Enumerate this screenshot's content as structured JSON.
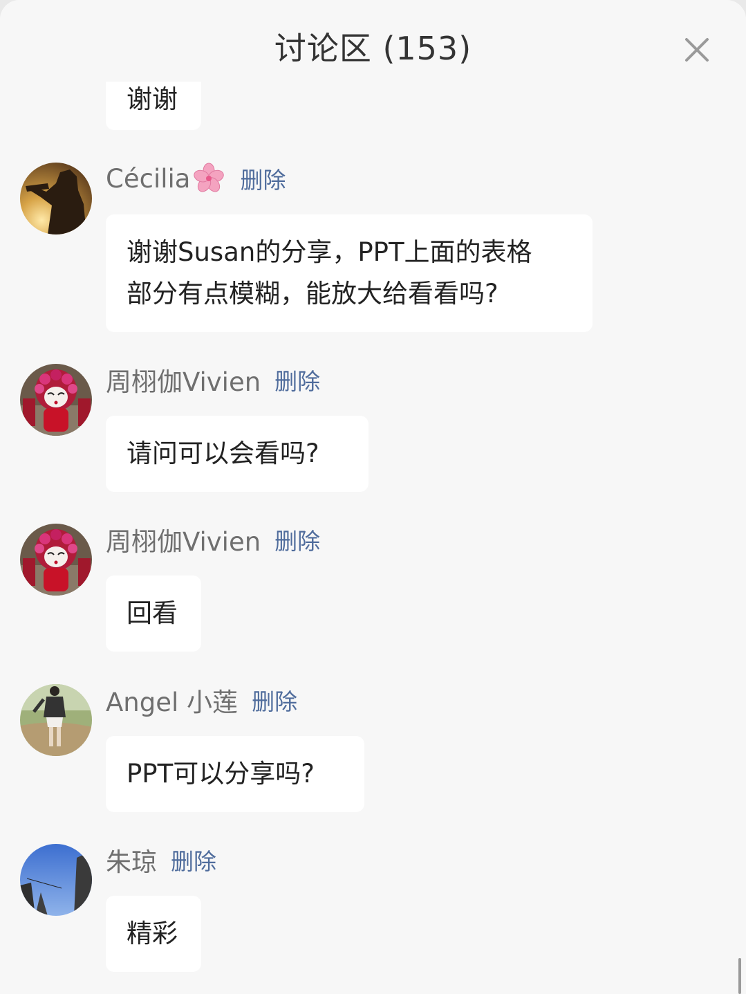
{
  "header": {
    "title": "讨论区 (153)"
  },
  "comments": [
    {
      "text": "谢谢"
    },
    {
      "user": "Cécilia",
      "user_emoji": "flower-icon",
      "delete_label": "删除",
      "text": "谢谢Susan的分享，PPT上面的表格\n部分有点模糊，能放大给看看吗?"
    },
    {
      "user": "周栩伽Vivien",
      "delete_label": "删除",
      "text": "请问可以会看吗?"
    },
    {
      "user": "周栩伽Vivien",
      "delete_label": "删除",
      "text": "回看"
    },
    {
      "user": "Angel 小莲",
      "delete_label": "删除",
      "text": "PPT可以分享吗?"
    },
    {
      "user": "朱琼",
      "delete_label": "删除",
      "text": "精彩"
    }
  ],
  "colors": {
    "background": "#f7f7f7",
    "bubble": "#ffffff",
    "username": "#6f6f6f",
    "delete_link": "#4f6c9c",
    "text": "#222222"
  }
}
